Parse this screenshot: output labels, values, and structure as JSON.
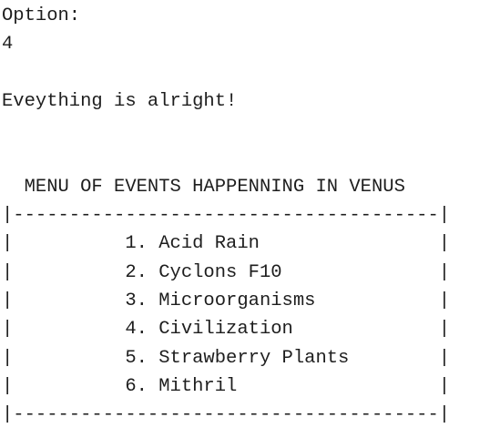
{
  "console": {
    "lines": [
      "Option:",
      "4",
      "",
      "Eveything is alright!",
      "",
      "",
      "  MENU OF EVENTS HAPPENNING IN VENUS",
      "|--------------------------------------|",
      "|          1. Acid Rain                |",
      "|          2. Cyclons F10              |",
      "|          3. Microorganisms           |",
      "|          4. Civilization             |",
      "|          5. Strawberry Plants        |",
      "|          6. Mithril                  |",
      "|--------------------------------------|"
    ]
  },
  "colors": {
    "background": "#ffffff",
    "text": "#1e1e1e"
  }
}
